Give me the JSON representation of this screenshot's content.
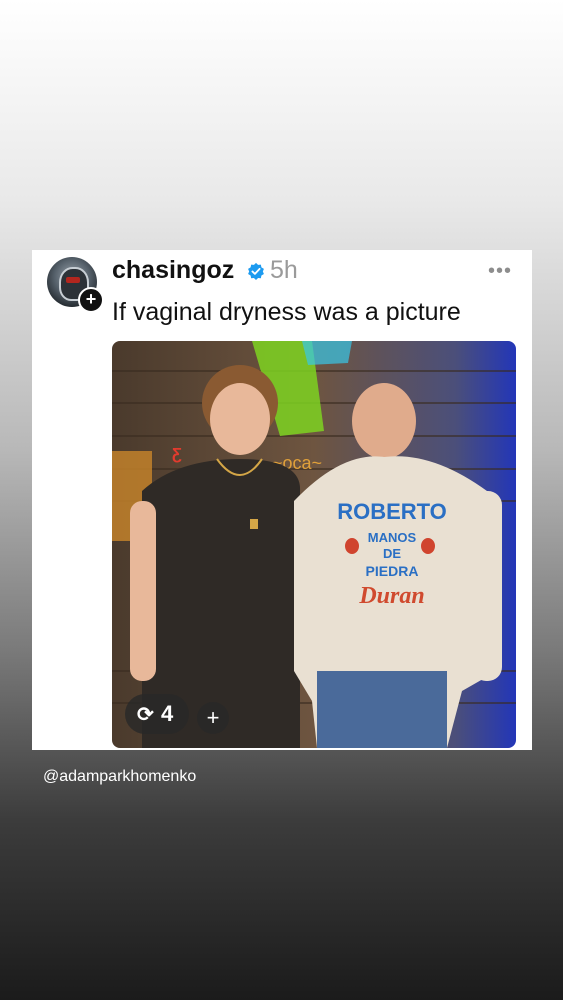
{
  "post": {
    "username": "chasingoz",
    "time": "5h",
    "text": "If vaginal dryness was a picture",
    "more": "•••",
    "follow_icon": "+",
    "verified_color": "#1d9bf0"
  },
  "photo": {
    "hoodie_lines": [
      "ROBERTO",
      "MANOS",
      "DE",
      "PIEDRA",
      "Duran"
    ]
  },
  "actions": {
    "repost_icon": "⟳",
    "repost_count": "4",
    "add_icon": "+"
  },
  "watermark": "@adamparkhomenko"
}
